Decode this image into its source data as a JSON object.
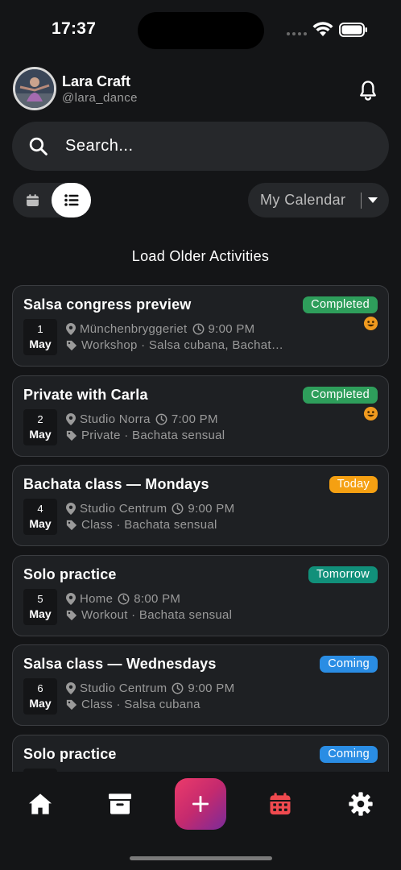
{
  "status_bar": {
    "time": "17:37"
  },
  "header": {
    "user_name": "Lara Craft",
    "user_handle": "@lara_dance"
  },
  "search": {
    "placeholder": "Search..."
  },
  "view_toggle": {
    "active": "list"
  },
  "calendar_select": {
    "label": "My Calendar"
  },
  "load_older": "Load Older Activities",
  "colors": {
    "completed": "#2e9e5b",
    "today": "#f5a012",
    "tomorrow": "#11907a",
    "coming": "#2a8de4",
    "calendar_icon": "#ef4a4f",
    "mood": "#f09a1f"
  },
  "activities": [
    {
      "title": "Salsa congress preview",
      "day": "1",
      "month": "May",
      "location": "Münchenbryggeriet",
      "time": "9:00 PM",
      "tags": "Workshop · Salsa cubana, Bachata sensual",
      "status": "Completed",
      "mood": true
    },
    {
      "title": "Private with Carla",
      "day": "2",
      "month": "May",
      "location": "Studio Norra",
      "time": "7:00 PM",
      "tags": "Private · Bachata sensual",
      "status": "Completed",
      "mood": true
    },
    {
      "title": "Bachata class — Mondays",
      "day": "4",
      "month": "May",
      "location": "Studio Centrum",
      "time": "9:00 PM",
      "tags": "Class · Bachata sensual",
      "status": "Today",
      "mood": false
    },
    {
      "title": "Solo practice",
      "day": "5",
      "month": "May",
      "location": "Home",
      "time": "8:00 PM",
      "tags": "Workout · Bachata sensual",
      "status": "Tomorrow",
      "mood": false
    },
    {
      "title": "Salsa class — Wednesdays",
      "day": "6",
      "month": "May",
      "location": "Studio Centrum",
      "time": "9:00 PM",
      "tags": "Class · Salsa cubana",
      "status": "Coming",
      "mood": false
    },
    {
      "title": "Solo practice",
      "day": "",
      "month": "",
      "location": "",
      "time": "",
      "tags": "",
      "status": "Coming",
      "mood": false
    }
  ],
  "bottom_nav": [
    {
      "icon": "home-icon"
    },
    {
      "icon": "archive-icon"
    },
    {
      "icon": "add-icon"
    },
    {
      "icon": "calendar-icon"
    },
    {
      "icon": "settings-icon"
    }
  ]
}
